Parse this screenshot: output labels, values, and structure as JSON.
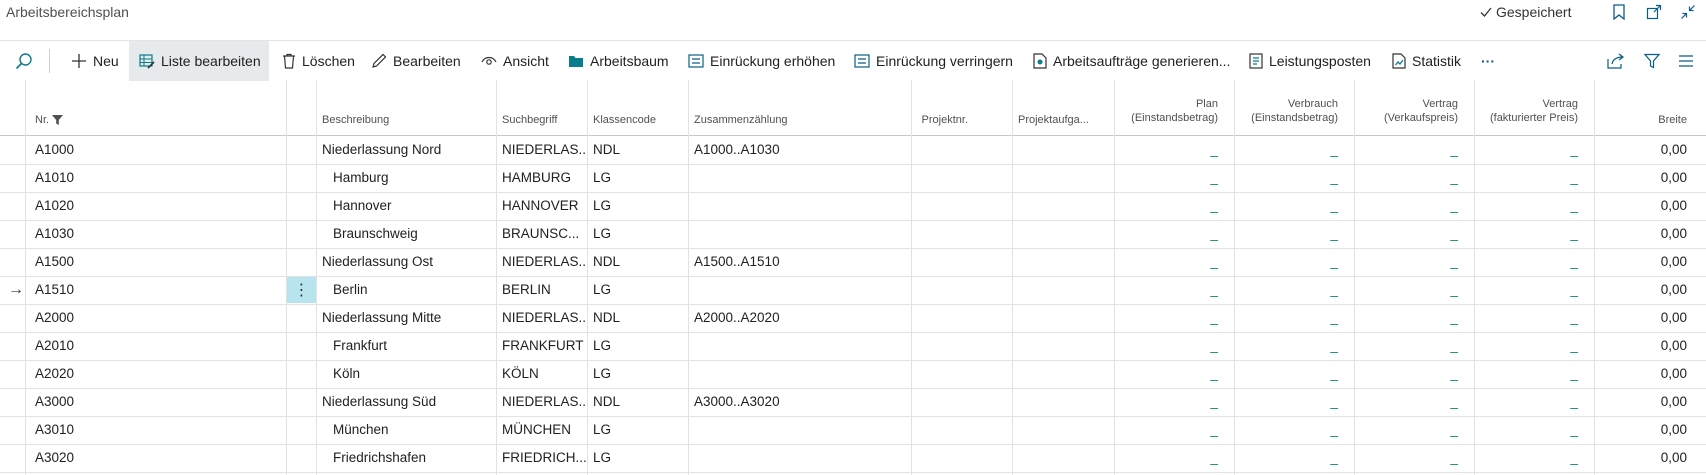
{
  "page": {
    "title": "Arbeitsbereichsplan",
    "saved_label": "Gespeichert"
  },
  "title_icons": [
    "bookmark-icon",
    "open-new-window-icon",
    "collapse-icon"
  ],
  "actions": {
    "search_icon": "search-icon",
    "new": "Neu",
    "edit_list": "Liste bearbeiten",
    "delete": "Löschen",
    "edit": "Bearbeiten",
    "view": "Ansicht",
    "tree": "Arbeitsbaum",
    "indent": "Einrückung erhöhen",
    "outdent": "Einrückung verringern",
    "generate": "Arbeitsaufträge generieren...",
    "ledger": "Leistungsposten",
    "stats": "Statistik",
    "more": "···"
  },
  "columns": {
    "nr": "Nr.",
    "beschreibung": "Beschreibung",
    "suchbegriff": "Suchbegriff",
    "klassencode": "Klassencode",
    "zusammenzaehlung": "Zusammenzählung",
    "projektnr": "Projektnr.",
    "projektaufgabe": "Projektaufga...",
    "plan_1": "Plan",
    "plan_2": "(Einstandsbetrag)",
    "verbrauch_1": "Verbrauch",
    "verbrauch_2": "(Einstandsbetrag)",
    "vertrag_vk_1": "Vertrag",
    "vertrag_vk_2": "(Verkaufspreis)",
    "vertrag_fakt_1": "Vertrag",
    "vertrag_fakt_2": "(fakturierter Preis)",
    "breite": "Breite"
  },
  "rows": [
    {
      "nr": "A1000",
      "beschreibung": "Niederlassung Nord",
      "suchbegriff": "NIEDERLAS...",
      "klassencode": "NDL",
      "zusammenzaehlung": "A1000..A1030",
      "plan": "_",
      "verbrauch": "_",
      "vertrag_vk": "_",
      "vertrag_fakt": "_",
      "breite": "0,00"
    },
    {
      "nr": "A1010",
      "beschreibung": "Hamburg",
      "suchbegriff": "HAMBURG",
      "klassencode": "LG",
      "zusammenzaehlung": "",
      "plan": "_",
      "verbrauch": "_",
      "vertrag_vk": "_",
      "vertrag_fakt": "_",
      "breite": "0,00"
    },
    {
      "nr": "A1020",
      "beschreibung": "Hannover",
      "suchbegriff": "HANNOVER",
      "klassencode": "LG",
      "zusammenzaehlung": "",
      "plan": "_",
      "verbrauch": "_",
      "vertrag_vk": "_",
      "vertrag_fakt": "_",
      "breite": "0,00"
    },
    {
      "nr": "A1030",
      "beschreibung": "Braunschweig",
      "suchbegriff": "BRAUNSC...",
      "klassencode": "LG",
      "zusammenzaehlung": "",
      "plan": "_",
      "verbrauch": "_",
      "vertrag_vk": "_",
      "vertrag_fakt": "_",
      "breite": "0,00"
    },
    {
      "nr": "A1500",
      "beschreibung": "Niederlassung Ost",
      "suchbegriff": "NIEDERLAS...",
      "klassencode": "NDL",
      "zusammenzaehlung": "A1500..A1510",
      "plan": "_",
      "verbrauch": "_",
      "vertrag_vk": "_",
      "vertrag_fakt": "_",
      "breite": "0,00"
    },
    {
      "nr": "A1510",
      "beschreibung": "Berlin",
      "suchbegriff": "BERLIN",
      "klassencode": "LG",
      "zusammenzaehlung": "",
      "plan": "_",
      "verbrauch": "_",
      "vertrag_vk": "_",
      "vertrag_fakt": "_",
      "breite": "0,00",
      "selected": true
    },
    {
      "nr": "A2000",
      "beschreibung": "Niederlassung Mitte",
      "suchbegriff": "NIEDERLAS...",
      "klassencode": "NDL",
      "zusammenzaehlung": "A2000..A2020",
      "plan": "_",
      "verbrauch": "_",
      "vertrag_vk": "_",
      "vertrag_fakt": "_",
      "breite": "0,00"
    },
    {
      "nr": "A2010",
      "beschreibung": "Frankfurt",
      "suchbegriff": "FRANKFURT",
      "klassencode": "LG",
      "zusammenzaehlung": "",
      "plan": "_",
      "verbrauch": "_",
      "vertrag_vk": "_",
      "vertrag_fakt": "_",
      "breite": "0,00"
    },
    {
      "nr": "A2020",
      "beschreibung": "Köln",
      "suchbegriff": "KÖLN",
      "klassencode": "LG",
      "zusammenzaehlung": "",
      "plan": "_",
      "verbrauch": "_",
      "vertrag_vk": "_",
      "vertrag_fakt": "_",
      "breite": "0,00"
    },
    {
      "nr": "A3000",
      "beschreibung": "Niederlassung Süd",
      "suchbegriff": "NIEDERLAS...",
      "klassencode": "NDL",
      "zusammenzaehlung": "A3000..A3020",
      "plan": "_",
      "verbrauch": "_",
      "vertrag_vk": "_",
      "vertrag_fakt": "_",
      "breite": "0,00"
    },
    {
      "nr": "A3010",
      "beschreibung": "München",
      "suchbegriff": "MÜNCHEN",
      "klassencode": "LG",
      "zusammenzaehlung": "",
      "plan": "_",
      "verbrauch": "_",
      "vertrag_vk": "_",
      "vertrag_fakt": "_",
      "breite": "0,00"
    },
    {
      "nr": "A3020",
      "beschreibung": "Friedrichshafen",
      "suchbegriff": "FRIEDRICH...",
      "klassencode": "LG",
      "zusammenzaehlung": "",
      "plan": "_",
      "verbrauch": "_",
      "vertrag_vk": "_",
      "vertrag_fakt": "_",
      "breite": "0,00"
    }
  ],
  "colors": {
    "accent": "#00897b",
    "selected_cell": "#b7e4ee",
    "selected_action": "#e6eaec"
  }
}
